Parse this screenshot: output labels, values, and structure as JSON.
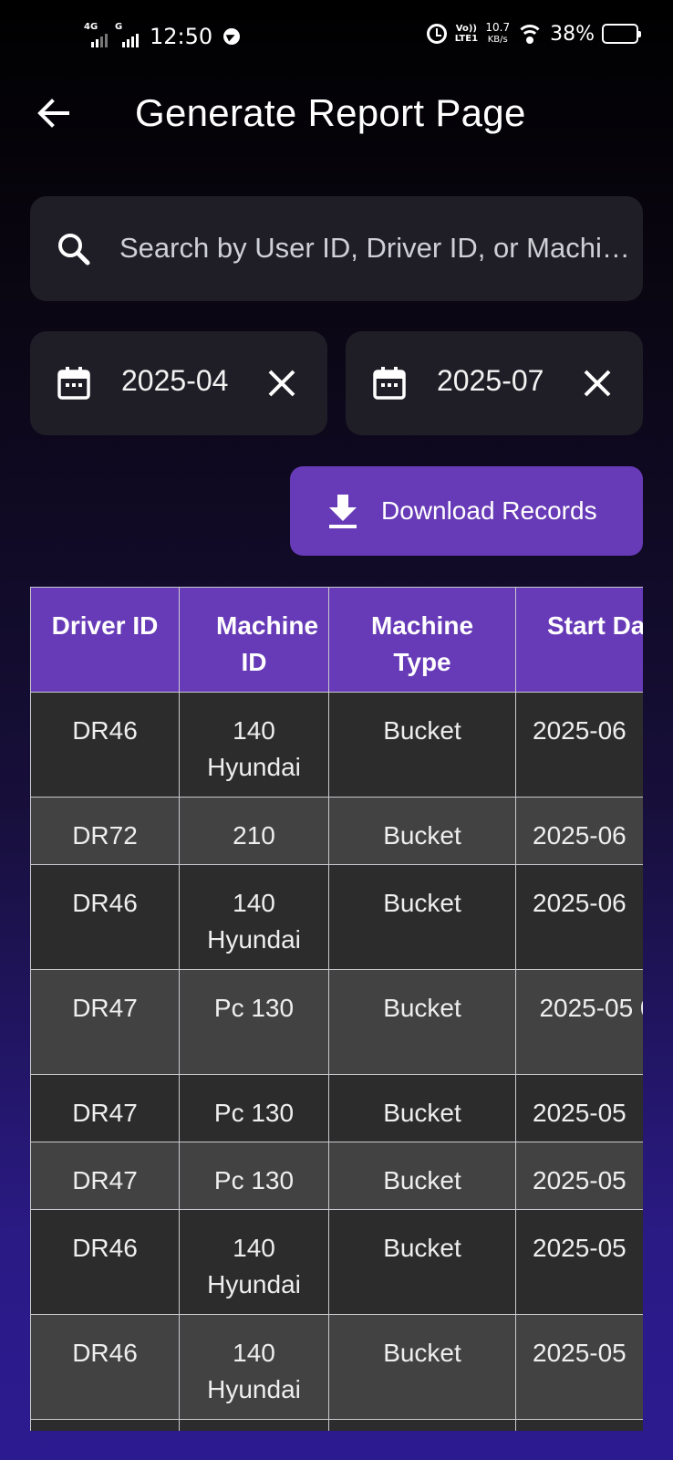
{
  "status_bar": {
    "network1": "4G",
    "network2": "G",
    "time": "12:50",
    "volte": "Vo)) LTE1",
    "speed_value": "10.7",
    "speed_unit": "KB/s",
    "battery_percent": "38%"
  },
  "header": {
    "title": "Generate Report Page",
    "back_icon": "arrow-left-icon"
  },
  "search": {
    "icon": "search-icon",
    "placeholder": "Search by User ID, Driver ID, or Machine ID",
    "value": ""
  },
  "date_filters": {
    "start": {
      "icon": "calendar-icon",
      "value": "2025-04",
      "clear_icon": "close-icon"
    },
    "end": {
      "icon": "calendar-icon",
      "value": "2025-07",
      "clear_icon": "close-icon"
    }
  },
  "download_button": {
    "icon": "download-icon",
    "label": "Download Records",
    "color": "#673ab7"
  },
  "table": {
    "header_color": "#673ab7",
    "columns": [
      "Driver ID",
      "Machine ID",
      "Machine Type",
      "Start Da"
    ],
    "rows": [
      {
        "driver_id": "DR46",
        "machine_id": "140 Hyundai",
        "machine_type": "Bucket",
        "start_date": "2025-06"
      },
      {
        "driver_id": "DR72",
        "machine_id": "210",
        "machine_type": "Bucket",
        "start_date": "2025-06"
      },
      {
        "driver_id": "DR46",
        "machine_id": "140 Hyundai",
        "machine_type": "Bucket",
        "start_date": "2025-06"
      },
      {
        "driver_id": "DR47",
        "machine_id": "Pc 130",
        "machine_type": "Bucket",
        "start_date": "2025-05 0"
      },
      {
        "driver_id": "DR47",
        "machine_id": "Pc 130",
        "machine_type": "Bucket",
        "start_date": "2025-05"
      },
      {
        "driver_id": "DR47",
        "machine_id": "Pc 130",
        "machine_type": "Bucket",
        "start_date": "2025-05"
      },
      {
        "driver_id": "DR46",
        "machine_id": "140 Hyundai",
        "machine_type": "Bucket",
        "start_date": "2025-05"
      },
      {
        "driver_id": "DR46",
        "machine_id": "140 Hyundai",
        "machine_type": "Bucket",
        "start_date": "2025-05"
      }
    ]
  }
}
